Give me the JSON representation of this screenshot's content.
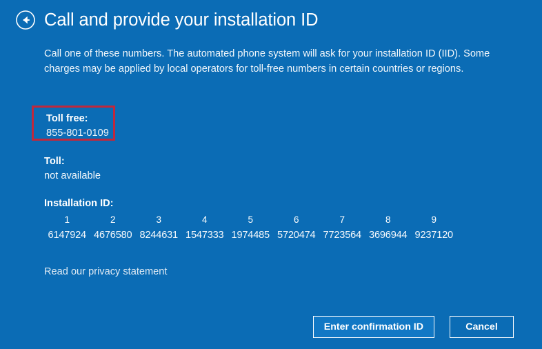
{
  "window": {
    "background_color": "#0b6cb5",
    "accent_color": "#1178c5",
    "highlight_color": "#c0283c"
  },
  "header": {
    "back_icon": "back-arrow-circle-icon",
    "title": "Call and provide your installation ID"
  },
  "main": {
    "intro": "Call one of these numbers. The automated phone system will ask for your installation ID (IID). Some charges may be applied by local operators for toll-free numbers in certain countries or regions.",
    "toll_free": {
      "label": "Toll free:",
      "value": "855-801-0109",
      "highlighted": true
    },
    "toll": {
      "label": "Toll:",
      "value": "not available"
    },
    "installation_id": {
      "label": "Installation ID:",
      "column_indexes": [
        "1",
        "2",
        "3",
        "4",
        "5",
        "6",
        "7",
        "8",
        "9"
      ],
      "groups": [
        "6147924",
        "4676580",
        "8244631",
        "1547333",
        "1974485",
        "5720474",
        "7723564",
        "3696944",
        "9237120"
      ]
    },
    "privacy_link": "Read our privacy statement"
  },
  "footer": {
    "primary_button": "Enter confirmation ID",
    "secondary_button": "Cancel"
  }
}
